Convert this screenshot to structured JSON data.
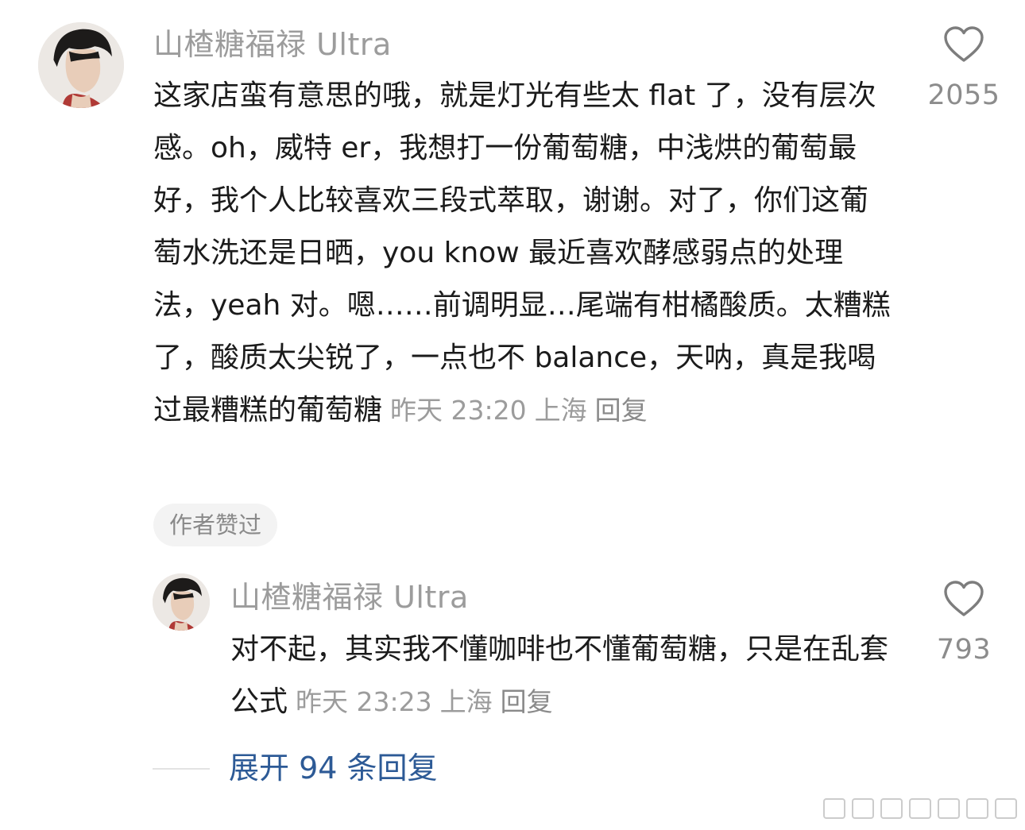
{
  "comment": {
    "username": "山楂糖福禄 Ultra",
    "text": "这家店蛮有意思的哦，就是灯光有些太 flat 了，没有层次感。oh，威特 er，我想打一份葡萄糖，中浅烘的葡萄最好，我个人比较喜欢三段式萃取，谢谢。对了，你们这葡萄水洗还是日晒，you know 最近喜欢酵感弱点的处理法，yeah 对。嗯……前调明显…尾端有柑橘酸质。太糟糕了，酸质太尖锐了，一点也不 balance，天呐，真是我喝过最糟糕的葡萄糖",
    "time": "昨天 23:20",
    "location": "上海",
    "reply_label": "回复",
    "likes": "2055",
    "author_liked_badge": "作者赞过",
    "like_icon": "heart-outline-icon"
  },
  "reply": {
    "username": "山楂糖福禄 Ultra",
    "text": "对不起，其实我不懂咖啡也不懂葡萄糖，只是在乱套公式",
    "time": "昨天 23:23",
    "location": "上海",
    "reply_label": "回复",
    "likes": "793",
    "like_icon": "heart-outline-icon"
  },
  "expand_replies": "展开 94 条回复",
  "colors": {
    "username": "#9c9c9c",
    "body_text": "#1b1b1b",
    "meta_text": "#9c9c9c",
    "link_blue": "#2d5a96",
    "badge_bg": "#f3f3f3"
  }
}
